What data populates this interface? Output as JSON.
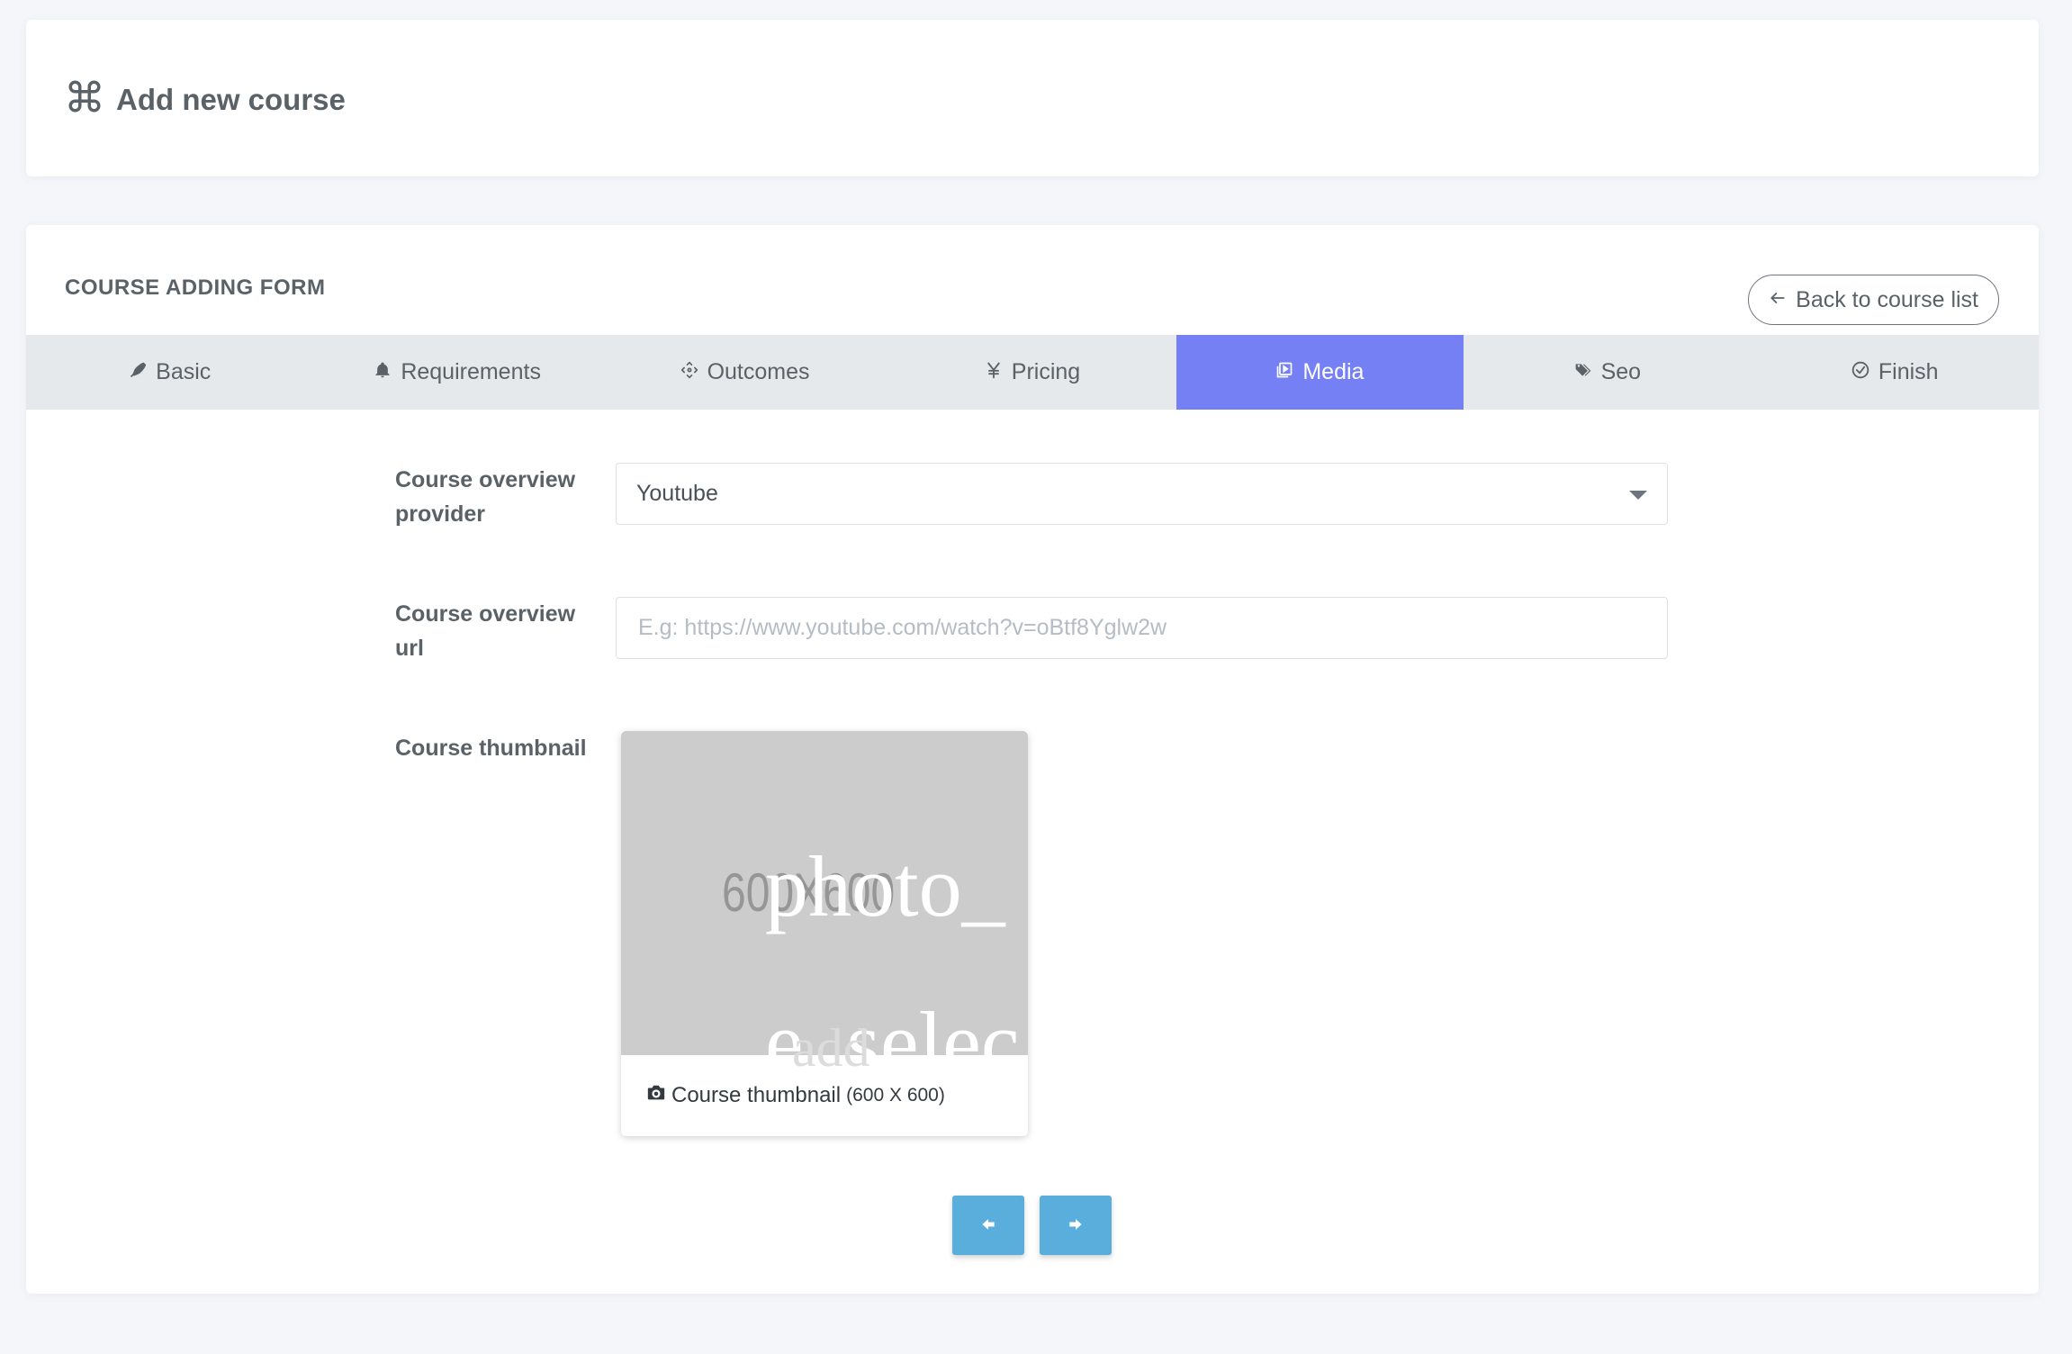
{
  "header": {
    "title": "Add new course",
    "icon": "command-icon"
  },
  "form": {
    "heading": "COURSE ADDING FORM",
    "back_button": "Back to course list",
    "tabs": [
      {
        "label": "Basic",
        "icon": "pen-icon"
      },
      {
        "label": "Requirements",
        "icon": "bell-icon"
      },
      {
        "label": "Outcomes",
        "icon": "move-icon"
      },
      {
        "label": "Pricing",
        "icon": "yen-icon"
      },
      {
        "label": "Media",
        "icon": "video-icon",
        "active": true
      },
      {
        "label": "Seo",
        "icon": "tags-icon"
      },
      {
        "label": "Finish",
        "icon": "check-circle-icon"
      }
    ],
    "fields": {
      "provider_label": "Course overview provider",
      "provider_value": "Youtube",
      "url_label": "Course overview url",
      "url_placeholder": "E.g: https://www.youtube.com/watch?v=oBtf8Yglw2w",
      "thumbnail_label": "Course thumbnail"
    },
    "thumbnail": {
      "placeholder_size": "600X600",
      "alt_text_line1": "photo_",
      "alt_text_line2": "e_selec",
      "alt_text_line3": "add",
      "caption": "Course thumbnail",
      "caption_size": "(600 X 600)"
    }
  },
  "colors": {
    "accent": "#7480f3",
    "nav_button": "#5aaedb",
    "background": "#f4f6f9"
  }
}
